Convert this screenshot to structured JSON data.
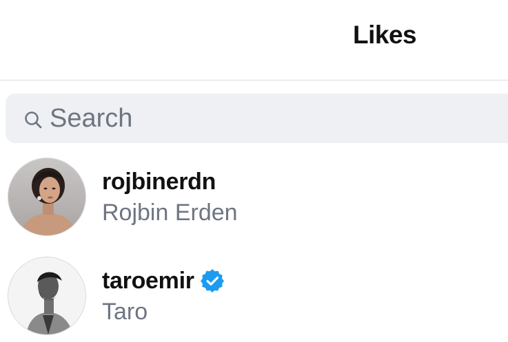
{
  "header": {
    "title": "Likes"
  },
  "search": {
    "placeholder": "Search",
    "value": "",
    "icon": "search-icon"
  },
  "likes": [
    {
      "username": "rojbinerdn",
      "full_name": "Rojbin Erden",
      "verified": false
    },
    {
      "username": "taroemir",
      "full_name": "Taro",
      "verified": true,
      "badge_icon": "verified-badge-icon"
    }
  ],
  "colors": {
    "background": "#ffffff",
    "search_background": "#eff0f3",
    "secondary_text": "#6e7582",
    "verified_blue": "#1d9bf0",
    "divider": "#dedede"
  }
}
